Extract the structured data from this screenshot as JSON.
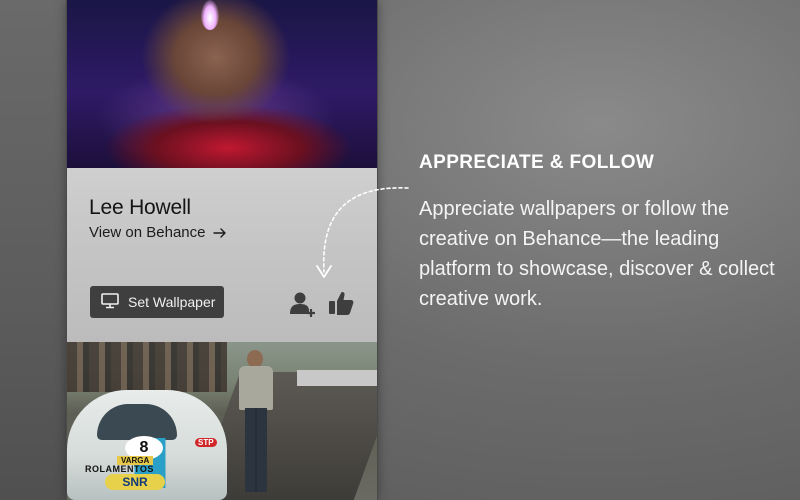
{
  "card": {
    "creator_name": "Lee Howell",
    "view_link": "View on Behance",
    "set_wallpaper_label": "Set Wallpaper",
    "icons": [
      "monitor-icon",
      "arrow-right-icon",
      "follow-user-icon",
      "thumbs-up-icon"
    ]
  },
  "bottom_wallpaper": {
    "car_number": "8",
    "sponsors": [
      "VARGA",
      "ROLAMENTOS",
      "SNR",
      "STP"
    ]
  },
  "annotation": {
    "title": "APPRECIATE & FOLLOW",
    "body": "Appreciate wallpapers or follow the creative on Behance—the leading platform to showcase, discover & collect creative work."
  },
  "colors": {
    "button_bg": "#3f3f3f",
    "card_bg": "#c8c8c8",
    "annotation_text": "#ffffff"
  }
}
